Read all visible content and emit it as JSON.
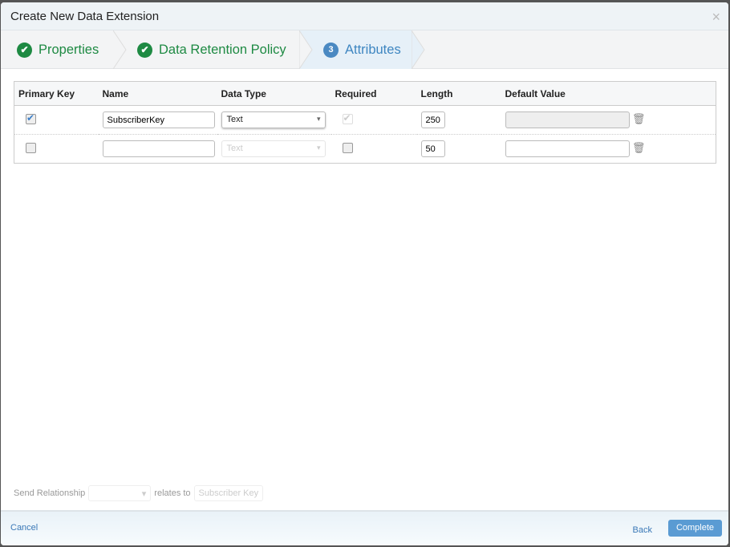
{
  "dialog": {
    "title": "Create New Data Extension",
    "close": "×"
  },
  "steps": [
    {
      "label": "Properties",
      "icon": "✔"
    },
    {
      "label": "Data Retention Policy",
      "icon": "✔"
    },
    {
      "label": "Attributes",
      "icon": "3"
    }
  ],
  "table": {
    "headers": [
      "Primary Key",
      "Name",
      "Data Type",
      "Required",
      "Length",
      "Default Value"
    ],
    "rows": [
      {
        "primary_key": true,
        "name": "SubscriberKey",
        "data_type": "Text",
        "required": true,
        "length": "250",
        "default": ""
      },
      {
        "primary_key": false,
        "name": "",
        "data_type": "Text",
        "required": false,
        "length": "50",
        "default": ""
      }
    ]
  },
  "relationship": {
    "label": "Send Relationship",
    "relates": "relates to",
    "target": "Subscriber Key"
  },
  "footer": {
    "cancel": "Cancel",
    "back": "Back",
    "complete": "Complete"
  }
}
